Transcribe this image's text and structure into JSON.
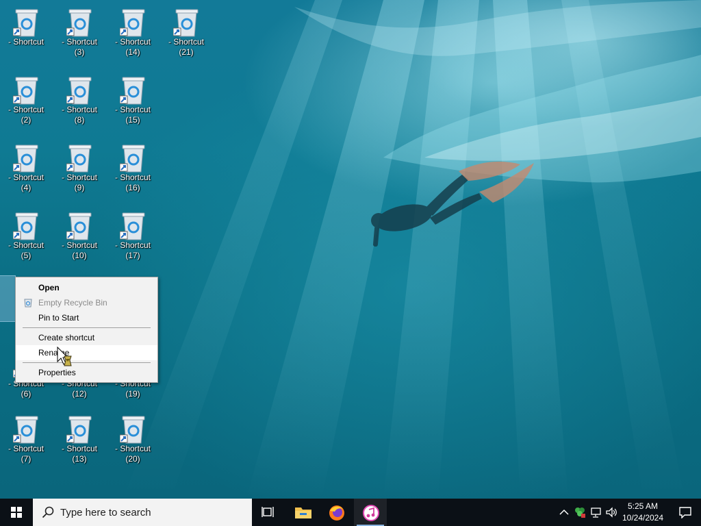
{
  "desktop": {
    "icons": [
      {
        "label": "- Shortcut"
      },
      {
        "label": "- Shortcut\n(2)"
      },
      {
        "label": "- Shortcut\n(4)"
      },
      {
        "label": "- Shortcut\n(5)"
      },
      {
        "label": ""
      },
      {
        "label": "- Shortcut\n(6)"
      },
      {
        "label": "- Shortcut\n(7)"
      },
      {
        "label": "- Shortcut\n(3)"
      },
      {
        "label": "- Shortcut\n(8)"
      },
      {
        "label": "- Shortcut\n(9)"
      },
      {
        "label": "- Shortcut\n(10)"
      },
      {
        "label": "- Shortcut\n(12)"
      },
      {
        "label": "- Shortcut\n(13)"
      },
      {
        "label": "- Shortcut\n(14)"
      },
      {
        "label": "- Shortcut\n(15)"
      },
      {
        "label": "- Shortcut\n(16)"
      },
      {
        "label": "- Shortcut\n(17)"
      },
      {
        "label": "- Shortcut\n(19)"
      },
      {
        "label": "- Shortcut\n(20)"
      },
      {
        "label": "- Shortcut\n(21)"
      }
    ],
    "icon_type": "recycle-bin-shortcut-icon"
  },
  "context_menu": {
    "open": "Open",
    "empty_recycle_bin": "Empty Recycle Bin",
    "pin_to_start": "Pin to Start",
    "create_shortcut": "Create shortcut",
    "rename": "Rename",
    "properties": "Properties"
  },
  "taskbar": {
    "search_placeholder": "Type here to search",
    "apps": [
      "task-view-icon",
      "file-explorer-icon",
      "firefox-icon",
      "itunes-icon"
    ],
    "time": "5:25 AM",
    "date": "10/24/2024"
  },
  "colors": {
    "taskbar": "#0b1016",
    "menu_bg": "#f2f2f2",
    "water": "#0f7a93"
  }
}
